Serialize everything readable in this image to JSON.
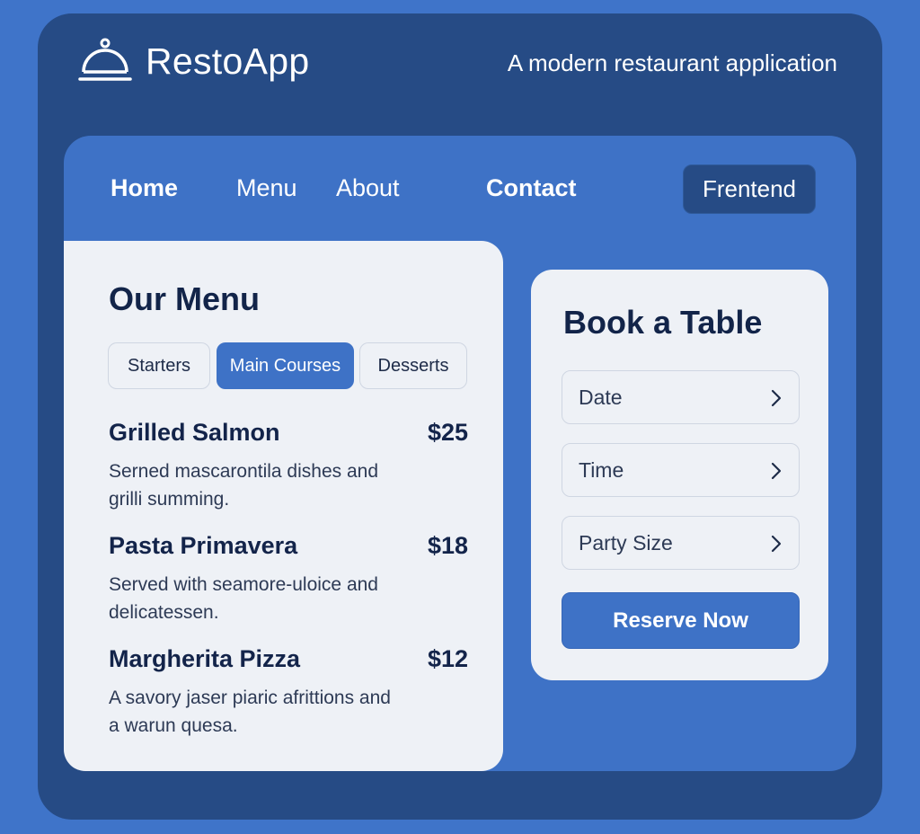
{
  "header": {
    "brand": "RestoApp",
    "tagline": "A modern restaurant application",
    "logo_icon": "cloche-icon"
  },
  "nav": {
    "items": [
      {
        "label": "Home",
        "active": true
      },
      {
        "label": "Menu"
      },
      {
        "label": "About"
      },
      {
        "label": "Contact"
      }
    ],
    "button_label": "Frentend"
  },
  "menu": {
    "title": "Our Menu",
    "tabs": [
      {
        "label": "Starters"
      },
      {
        "label": "Main Courses",
        "selected": true
      },
      {
        "label": "Desserts"
      }
    ],
    "items": [
      {
        "name": "Grilled Salmon",
        "price": "$25",
        "description": "Serned mascarontila dishes and grilli summing."
      },
      {
        "name": "Pasta Primavera",
        "price": "$18",
        "description": "Served with seamore-uloice and delicatessen."
      },
      {
        "name": "Margherita Pizza",
        "price": "$12",
        "description": "A savory jaser piaric afrittions and a warun quesa."
      }
    ]
  },
  "booking": {
    "title": "Book a Table",
    "fields": [
      {
        "label": "Date"
      },
      {
        "label": "Time"
      },
      {
        "label": "Party Size"
      }
    ],
    "submit_label": "Reserve Now",
    "chevron_icon": "chevron-right-icon"
  },
  "colors": {
    "background": "#3f74c9",
    "frame": "#264b85",
    "accent": "#3e72c6",
    "card": "#eef1f6",
    "text_dark": "#122449"
  }
}
